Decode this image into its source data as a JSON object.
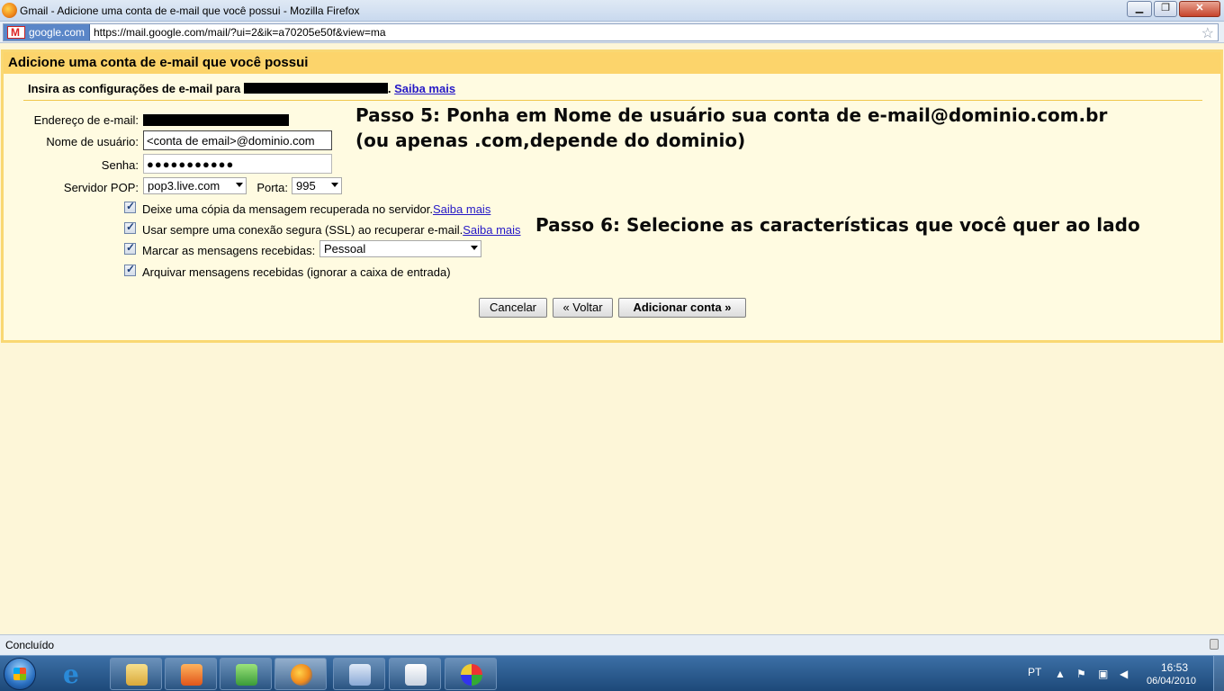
{
  "window": {
    "title": "Gmail - Adicione uma conta de e-mail que você possui - Mozilla Firefox"
  },
  "address_bar": {
    "site_badge": "google.com",
    "url": "https://mail.google.com/mail/?ui=2&ik=a70205e50f&view=ma"
  },
  "dialog": {
    "title": "Adicione uma conta de e-mail que você possui",
    "instruction": "Insira as configurações de e-mail para",
    "instruction_suffix": ".",
    "learn_more": "Saiba mais",
    "fields": {
      "email_label": "Endereço de e-mail:",
      "username_label": "Nome de usuário:",
      "username_value": "<conta de email>@dominio.com",
      "password_label": "Senha:",
      "password_value": "●●●●●●●●●●●",
      "pop_label": "Servidor POP:",
      "pop_value": "pop3.live.com",
      "port_label": "Porta:",
      "port_value": "995"
    },
    "options": {
      "leave_copy": "Deixe uma cópia da mensagem recuperada no servidor.",
      "leave_copy_link": "Saiba mais",
      "use_ssl": "Usar sempre uma conexão segura (SSL) ao recuperar e-mail.",
      "use_ssl_link": "Saiba mais",
      "label_incoming": "Marcar as mensagens recebidas:",
      "label_value": "Pessoal",
      "archive": "Arquivar mensagens recebidas (ignorar a caixa de entrada)"
    },
    "buttons": {
      "cancel": "Cancelar",
      "back": "« Voltar",
      "add": "Adicionar conta »"
    }
  },
  "notes": {
    "step5_line1": "Passo 5: Ponha em Nome de usuário sua conta de e-mail@dominio.com.br",
    "step5_line2": "(ou apenas .com,depende do dominio)",
    "step6": "Passo 6: Selecione as características que você quer ao lado"
  },
  "status_bar": {
    "text": "Concluído"
  },
  "taskbar": {
    "language": "PT",
    "time": "16:53",
    "date": "06/04/2010",
    "items": [
      "explorer-icon",
      "media-player-icon",
      "messenger-icon",
      "firefox-icon",
      "jc-icon",
      "notepad-icon",
      "paint-icon"
    ]
  }
}
